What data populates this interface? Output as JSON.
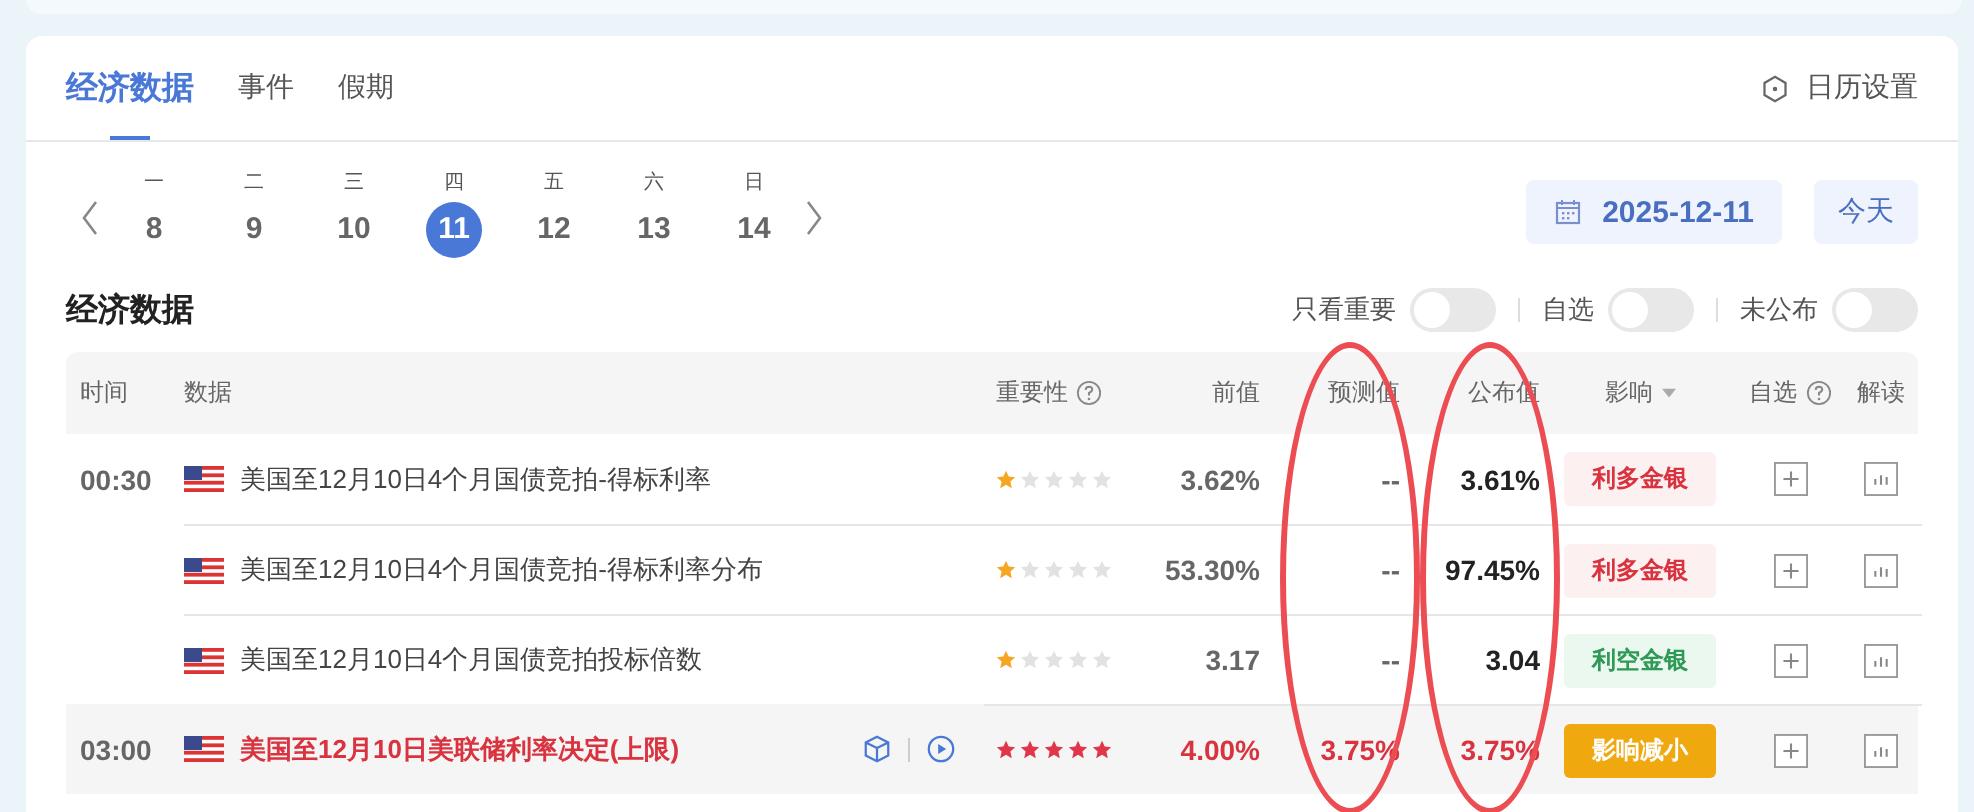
{
  "tabs": [
    {
      "label": "经济数据",
      "selected": true
    },
    {
      "label": "事件",
      "selected": false
    },
    {
      "label": "假期",
      "selected": false
    }
  ],
  "settings_link": "日历设置",
  "days": [
    {
      "weekday": "一",
      "day": "8",
      "selected": false
    },
    {
      "weekday": "二",
      "day": "9",
      "selected": false
    },
    {
      "weekday": "三",
      "day": "10",
      "selected": false
    },
    {
      "weekday": "四",
      "day": "11",
      "selected": true
    },
    {
      "weekday": "五",
      "day": "12",
      "selected": false
    },
    {
      "weekday": "六",
      "day": "13",
      "selected": false
    },
    {
      "weekday": "日",
      "day": "14",
      "selected": false
    }
  ],
  "date_button": "2025-12-11",
  "today_button": "今天",
  "section_title": "经济数据",
  "filters": [
    {
      "label": "只看重要",
      "on": false
    },
    {
      "label": "自选",
      "on": false
    },
    {
      "label": "未公布",
      "on": false
    }
  ],
  "table": {
    "columns": [
      {
        "label": "时间",
        "help": false,
        "sort": false,
        "circled": false
      },
      {
        "label": "数据",
        "help": false,
        "sort": false,
        "circled": false
      },
      {
        "label": "重要性",
        "help": true,
        "sort": false,
        "circled": false
      },
      {
        "label": "前值",
        "help": false,
        "sort": false,
        "circled": false
      },
      {
        "label": "预测值",
        "help": false,
        "sort": false,
        "circled": true
      },
      {
        "label": "公布值",
        "help": false,
        "sort": false,
        "circled": true
      },
      {
        "label": "影响",
        "help": false,
        "sort": true,
        "circled": false
      },
      {
        "label": "自选",
        "help": true,
        "sort": false,
        "circled": false
      },
      {
        "label": "解读",
        "help": false,
        "sort": false,
        "circled": false
      }
    ],
    "rows": [
      {
        "kind": "normal",
        "time": "00:30",
        "name": "美国至12月10日4个月国债竞拍-得标利率",
        "media": false,
        "stars": 1,
        "previous": "3.62%",
        "forecast": "--",
        "actual": "3.61%",
        "impact": {
          "label": "利多金银",
          "kind": "bullish"
        }
      },
      {
        "kind": "normal",
        "name": "美国至12月10日4个月国债竞拍-得标利率分布",
        "media": false,
        "stars": 1,
        "previous": "53.30%",
        "forecast": "--",
        "actual": "97.45%",
        "impact": {
          "label": "利多金银",
          "kind": "bullish"
        }
      },
      {
        "kind": "normal",
        "name": "美国至12月10日4个月国债竞拍投标倍数",
        "media": false,
        "stars": 1,
        "previous": "3.17",
        "forecast": "--",
        "actual": "3.04",
        "impact": {
          "label": "利空金银",
          "kind": "bearish"
        }
      },
      {
        "kind": "major",
        "time": "03:00",
        "name": "美国至12月10日美联储利率决定(上限)",
        "media": true,
        "stars": 5,
        "previous": "4.00%",
        "forecast": "3.75%",
        "actual": "3.75%",
        "impact": {
          "label": "影响减小",
          "kind": "reduced"
        }
      }
    ]
  }
}
